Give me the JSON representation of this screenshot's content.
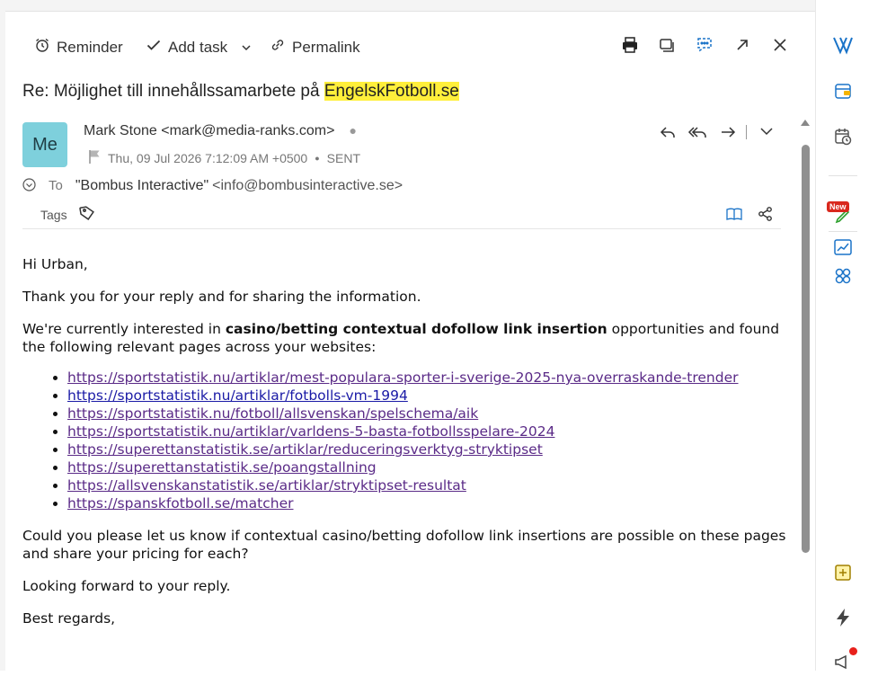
{
  "toolbar": {
    "reminder_label": "Reminder",
    "add_task_label": "Add task",
    "permalink_label": "Permalink"
  },
  "email": {
    "subject_prefix": "Re: Möjlighet till innehållssamarbete på ",
    "subject_highlight": "EngelskFotboll.se",
    "avatar_initials": "Me",
    "from": "Mark Stone <mark@media-ranks.com>",
    "date": "Thu, 09 Jul 2026 7:12:09 AM +0500",
    "status": "SENT",
    "to_label": "To",
    "to_name": "\"Bombus Interactive\"",
    "to_address": "<info@bombusinteractive.se>",
    "tags_label": "Tags"
  },
  "body": {
    "greeting": "Hi Urban,",
    "p1": "Thank you for your reply and for sharing the information.",
    "p2_before": "We're currently interested in ",
    "p2_bold": "casino/betting contextual dofollow link insertion",
    "p2_after": " opportunities and found the following relevant pages across your websites:",
    "links": [
      "https://sportstatistik.nu/artiklar/mest-populara-sporter-i-sverige-2025-nya-overraskande-trender",
      "https://sportstatistik.nu/artiklar/fotbolls-vm-1994",
      "https://sportstatistik.nu/fotboll/allsvenskan/spelschema/aik",
      "https://sportstatistik.nu/artiklar/varldens-5-basta-fotbollsspelare-2024",
      "https://superettanstatistik.se/artiklar/reduceringsverktyg-stryktipset",
      "https://superettanstatistik.se/poangstallning",
      "https://allsvenskanstatistik.se/artiklar/stryktipset-resultat",
      "https://spanskfotboll.se/matcher"
    ],
    "p3": "Could you please let us know if contextual casino/betting dofollow link insertions are possible on these pages and share your pricing for each?",
    "p4": "Looking forward to your reply.",
    "p5": "Best regards,"
  },
  "sidebar": {
    "new_badge": "New"
  },
  "colors": {
    "accent": "#1a73c8",
    "avatar_bg": "#7ed0dc",
    "highlight": "#ffef3b",
    "link": "#5a2a87"
  }
}
